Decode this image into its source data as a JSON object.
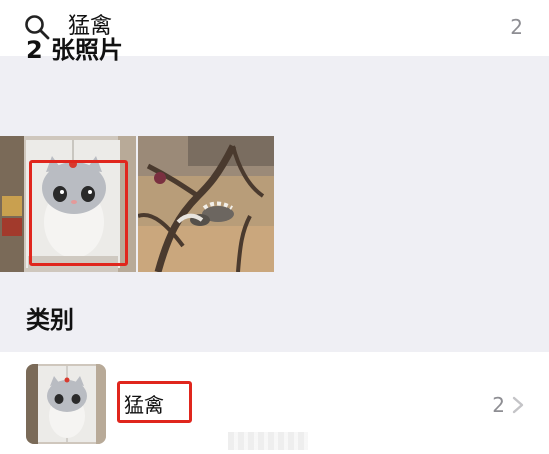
{
  "search": {
    "query": "猛禽",
    "count": "2"
  },
  "photos_section": {
    "title": "2 张照片"
  },
  "categories_section": {
    "title": "类别",
    "items": [
      {
        "label": "猛禽",
        "count": "2"
      }
    ]
  },
  "icons": {
    "search": "search-icon",
    "chevron": "chevron-right-icon"
  },
  "colors": {
    "highlight": "#e0261d",
    "secondary_text": "#8e8e93"
  }
}
